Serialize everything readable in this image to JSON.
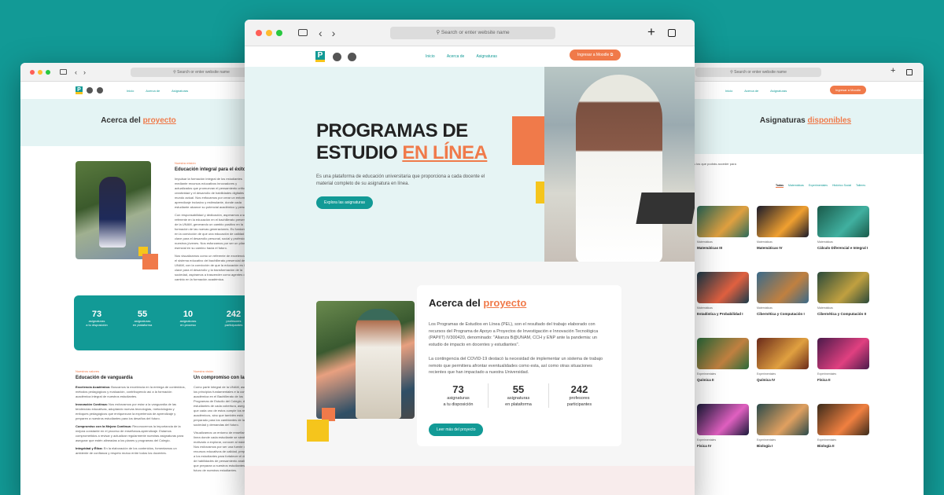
{
  "browser": {
    "url_placeholder": "Search or enter website name"
  },
  "nav": {
    "links": [
      "Inicio",
      "Acerca de",
      "Asignaturas"
    ],
    "cta": "Ingresar a Moodle"
  },
  "hero": {
    "title_line1": "PROGRAMAS DE",
    "title_line2_a": "ESTUDIO ",
    "title_line2_b": "EN LÍNEA",
    "description": "Es una plataforma de educación universitaria que proporciona a cada docente el material completo de su asignatura en línea.",
    "button": "Explora las asignaturas"
  },
  "about": {
    "title_a": "Acerca del ",
    "title_b": "proyecto",
    "p1": "Los Programas de Estudios en Línea (PEL), son el resultado del trabajo elaborado con recursos del Programa de Apoyo a Proyectos de Investigación e Innovación Tecnológica (PAPIIT) IV300420, denominado: \"Alianza B@UNAM, CCH y ENP ante la pandemia: un estudio de impacto en docentes y estudiantes\".",
    "p2": "La contingencia del COVID-19 destacó la necesidad de implementar un sistema de trabajo remoto que permitiera afrontar eventualidades como esta, así como otras situaciones recientes que han impactado a nuestra Universidad.",
    "stats": [
      {
        "value": "73",
        "label1": "asignaturas",
        "label2": "a tu disposición"
      },
      {
        "value": "55",
        "label1": "asignaturas",
        "label2": "en plataforma"
      },
      {
        "value": "242",
        "label1": "profesores",
        "label2": "participantes"
      }
    ],
    "button": "Leer más del proyecto"
  },
  "left": {
    "title_a": "Acerca del ",
    "title_b": "proyecto",
    "mission_tag": "Nuestra misión",
    "mission_title": "Educación integral para el éxito",
    "mission_p1": "Impulsar la formación integral de los estudiantes mediante recursos educativos innovadores y actualizados que promuevan el pensamiento crítico, la creatividad y el desarrollo de habilidades digitales en un mundo actual. Nos enfocamos por crear un entorno de aprendizaje inclusivo y estimulante, donde cada estudiante alcance su potencial académico y personal.",
    "mission_p2": "Con responsabilidad y dedicación, asperamos a ser un referente en la educación en el bachillerato presencial de la UNAM, generando un cambio positivo en la formación de las nuevas generaciones. Es fundamental en la convicción de que una educación de calidad es clave para el desarrollo personal, social y profesional de nuestros jóvenes. Nos esforzamos por ser un pilar esencial en su camino hacia el futuro.",
    "mission_p3": "Nos visualizamos como un referente de excelencia en el sistema educativo del bachillerato presencial de la UNAM, con la convicción de que la educación es la clave para el desarrollo y la transformación de la sociedad, aspiramos a trascender como agentes de cambio en la formación académica.",
    "stats": [
      {
        "value": "73",
        "label1": "asignaturas",
        "label2": "a tu disposición"
      },
      {
        "value": "55",
        "label1": "asignaturas",
        "label2": "en plataforma"
      },
      {
        "value": "10",
        "label1": "asignaturas",
        "label2": "en proceso"
      },
      {
        "value": "242",
        "label1": "profesores",
        "label2": "participantes"
      }
    ],
    "values_tag": "Nuestros valores",
    "values_title": "Educación de vanguardia",
    "values": [
      {
        "name": "Excelencia Académica:",
        "text": " Buscamos la excelencia en la entrega de contenidos, métodos pedagógicos y evaluación, contribuyendo así a la formación académica integral de nuestros estudiantes."
      },
      {
        "name": "Innovación Continua:",
        "text": " Nos esforzamos por estar a la vanguardia de las tendencias educativas, adoptando nuevas tecnologías, metodologías y enfoques pedagógicos que enriquezcan la experiencia de aprendizaje y preparen a nuestros estudiantes para los desafíos del futuro."
      },
      {
        "name": "Compromiso con la Mejora Continua:",
        "text": " Reconocemos la importancia de la mejora constante en el proceso de enseñanza-aprendizaje. Estamos comprometidos a revisar y actualizar regularmente nuestras asignaturas para asegurar que estén alineadas a los planes y programas del Colegio."
      },
      {
        "name": "Integridad y Ética:",
        "text": " En la elaboración de los contenidos, fomentamos un ambiente de confianza y respeto mutuo entre todos los docentes."
      }
    ],
    "vision_tag": "Nuestra visión",
    "vision_title": "Un compromiso con la excelencia",
    "vision_p1": "Como parte integral de la UNAM, asumimos los principios fundamentales e la continuidad académica en el Bachillerato de los Programas de Estudio del Colegio, desde estudiantes de cada cobertura, asegurando que cada uno de estos cumple los requisitos académicos, sino que también está preparado para los cambiantes de la sociedad y demandas del futuro.",
    "vision_p2": "Visualizamos un entorno de enseñanza en línea donde cada estudiante se sienta motivado a explorar, conocer al máximo. Nos esforzamos por ser una fuente de recursos educativos de calidad, preparando a los estudiantes para fortalecer el desarrollo de habilidades de pensamiento analítico, que preparan a nuestros estudiantes para el futuro de nuestros estudiantes."
  },
  "right": {
    "title_a": "Asignaturas ",
    "title_b": "disponibles",
    "intro": "s los que podrás acceder para",
    "section_label": "NTO",
    "filters": [
      "Todas",
      "Matemáticas",
      "Experimentales",
      "Histórico Social",
      "Talleres"
    ],
    "cards": [
      {
        "category": "Matemáticas",
        "name": "Matemáticas III"
      },
      {
        "category": "Matemáticas",
        "name": "Matemáticas IV"
      },
      {
        "category": "Matemáticas",
        "name": "Cálculo Diferencial e Integral I"
      },
      {
        "category": "Matemáticas",
        "name": "Estadística y Probabilidad I"
      },
      {
        "category": "Matemáticas",
        "name": "Cibernética y Computación I"
      },
      {
        "category": "Matemáticas",
        "name": "Cibernética y Computación II"
      },
      {
        "category": "Experimentales",
        "name": "Química II"
      },
      {
        "category": "Experimentales",
        "name": "Química IV"
      },
      {
        "category": "Experimentales",
        "name": "Física II"
      },
      {
        "category": "Experimentales",
        "name": "Física IV"
      },
      {
        "category": "Experimentales",
        "name": "Biología I"
      },
      {
        "category": "Experimentales",
        "name": "Biología II"
      }
    ]
  },
  "colors": {
    "teal": "#129a96",
    "orange": "#f07a4a",
    "yellow": "#f5c51c"
  }
}
